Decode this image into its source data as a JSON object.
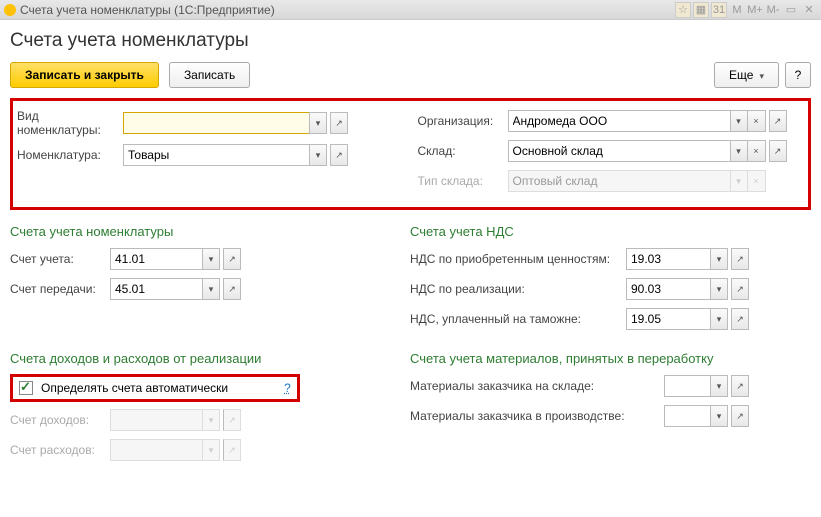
{
  "window": {
    "title": "Счета учета номенклатуры  (1С:Предприятие)"
  },
  "header": {
    "title": "Счета учета номенклатуры"
  },
  "toolbar": {
    "save_close": "Записать и закрыть",
    "save": "Записать",
    "more": "Еще",
    "help": "?"
  },
  "top": {
    "vid_label": "Вид номенклатуры:",
    "vid_value": "",
    "nom_label": "Номенклатура:",
    "nom_value": "Товары",
    "org_label": "Организация:",
    "org_value": "Андромеда ООО",
    "sklad_label": "Склад:",
    "sklad_value": "Основной склад",
    "tip_label": "Тип склада:",
    "tip_value": "Оптовый склад"
  },
  "acct": {
    "section": "Счета учета номенклатуры",
    "schet_label": "Счет учета:",
    "schet_value": "41.01",
    "pered_label": "Счет передачи:",
    "pered_value": "45.01"
  },
  "nds": {
    "section": "Счета учета НДС",
    "priob_label": "НДС по приобретенным ценностям:",
    "priob_value": "19.03",
    "real_label": "НДС по реализации:",
    "real_value": "90.03",
    "tam_label": "НДС, уплаченный на таможне:",
    "tam_value": "19.05"
  },
  "dohod": {
    "section": "Счета доходов и расходов от реализации",
    "auto_label": "Определять счета автоматически",
    "q": "?",
    "doh_label": "Счет доходов:",
    "doh_value": "",
    "ras_label": "Счет расходов:",
    "ras_value": ""
  },
  "mater": {
    "section": "Счета учета материалов, принятых в переработку",
    "sklad_label": "Материалы заказчика на складе:",
    "sklad_value": "",
    "proizv_label": "Материалы заказчика в производстве:",
    "proizv_value": ""
  }
}
